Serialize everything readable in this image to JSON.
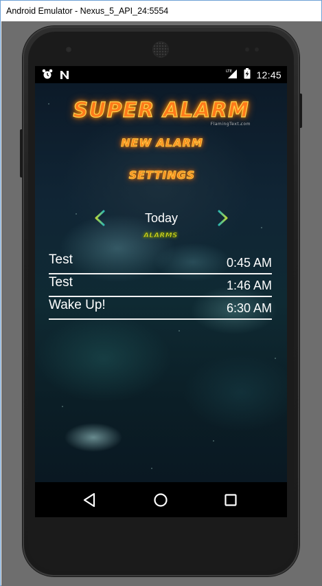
{
  "window": {
    "title": "Android Emulator - Nexus_5_API_24:5554"
  },
  "statusbar": {
    "left_icons": [
      "alarm-clock-icon",
      "n-notification-icon"
    ],
    "network": "LTE",
    "time": "12:45"
  },
  "app": {
    "logo_title": "SUPER ALARM",
    "logo_credit": "FlamingText.com",
    "new_alarm_label": "NEW ALARM",
    "settings_label": "SETTINGS",
    "day_label": "Today",
    "alarms_header": "ALARMS",
    "alarms": [
      {
        "name": "Test",
        "time": "0:45 AM"
      },
      {
        "name": "Test",
        "time": "1:46 AM"
      },
      {
        "name": "Wake Up!",
        "time": "6:30 AM"
      }
    ]
  },
  "navbar": {
    "buttons": [
      "back-icon",
      "home-icon",
      "recents-icon"
    ]
  },
  "colors": {
    "flame_orange": "#ff7a1a",
    "flame_yellow": "#ffd24d",
    "alarms_tag": "#d7e12a"
  }
}
